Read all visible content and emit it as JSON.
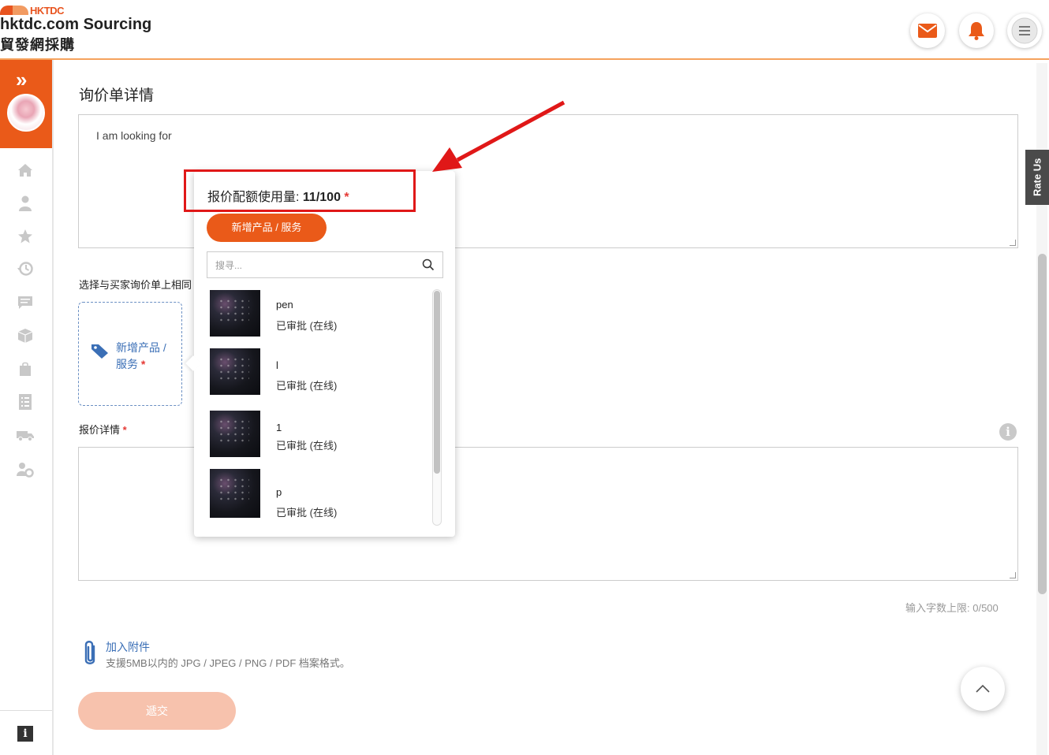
{
  "header": {
    "brand_small": "HKTDC",
    "title": "hktdc.com Sourcing",
    "subtitle": "貿發網採購",
    "colors": {
      "brand": "#ea5a19"
    },
    "icons": [
      "mail-icon",
      "bell-icon",
      "menu-icon"
    ]
  },
  "sidebar": {
    "icons": [
      "expand-chevron-icon",
      "home-icon",
      "user-icon",
      "star-icon",
      "history-icon",
      "message-icon",
      "box-icon",
      "bag-icon",
      "list-icon",
      "truck-icon",
      "user-settings-icon",
      "info-icon"
    ]
  },
  "main": {
    "title": "询价单详情",
    "enquiry_text": "I am looking for",
    "select_label": "选择与买家询价单上相同",
    "add_card_label": "新增产品 / 服务",
    "required_mark": "*",
    "detail_label": "报价详情",
    "char_limit": "输入字数上限: 0/500",
    "attach_label": "加入附件",
    "attach_hint": "支援5MB以内的 JPG / JPEG / PNG / PDF 档案格式。",
    "submit_label": "遞交",
    "rate_us": "Rate Us"
  },
  "dropdown": {
    "quota_label": "报价配额使用量: ",
    "quota_value": "11/100",
    "add_button": "新增产品 / 服务",
    "search_placeholder": "搜寻...",
    "items": [
      {
        "name": "pen",
        "status": "已审批 (在线)"
      },
      {
        "name": "l",
        "status": "已审批 (在线)"
      },
      {
        "name": "1",
        "status": "已审批 (在线)"
      },
      {
        "name": "p",
        "status": "已审批 (在线)"
      }
    ]
  }
}
